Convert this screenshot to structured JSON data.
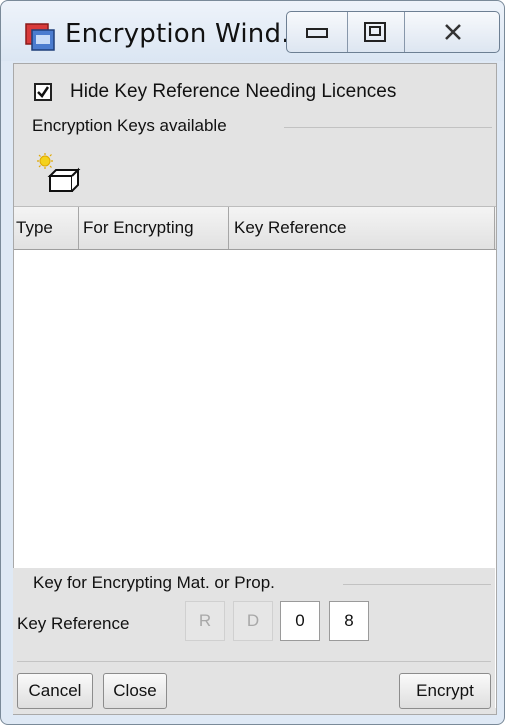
{
  "window": {
    "title": "Encryption Wind..."
  },
  "options": {
    "hide_key_reference_label": "Hide Key Reference Needing Licences",
    "hide_key_reference_checked": true
  },
  "keys_group": {
    "title": "Encryption Keys available"
  },
  "table": {
    "columns": [
      "Type",
      "For Encrypting",
      "Key Reference"
    ],
    "rows": []
  },
  "key_group": {
    "title": "Key for Encrypting Mat. or Prop.",
    "key_reference_label": "Key Reference",
    "fields": [
      "R",
      "D",
      "0",
      "8"
    ]
  },
  "buttons": {
    "cancel": "Cancel",
    "close": "Close",
    "encrypt": "Encrypt"
  },
  "icons": {
    "app": "encryption-app-icon",
    "new_key": "new-key-icon"
  }
}
